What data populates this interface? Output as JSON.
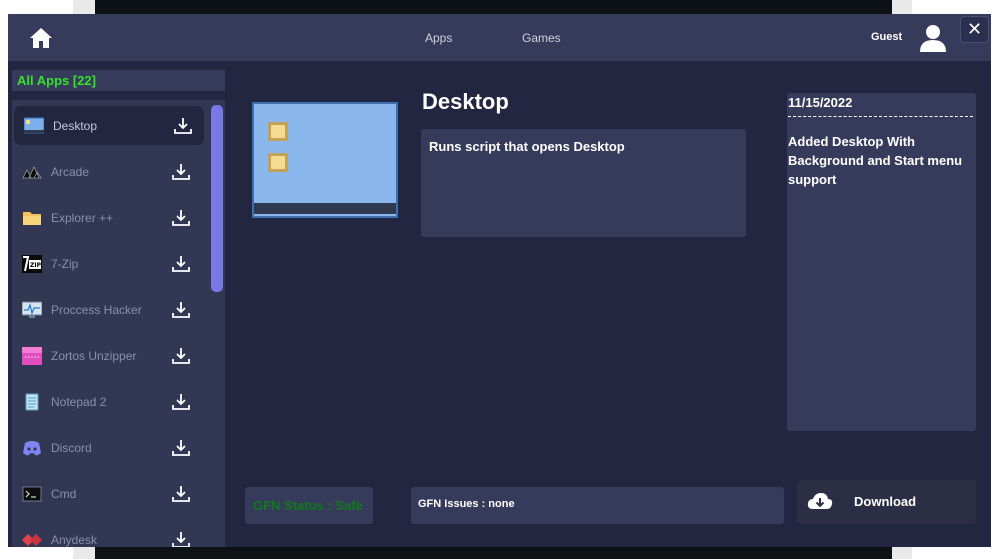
{
  "topbar": {
    "home_icon": "home-icon",
    "nav": [
      "Apps",
      "Games"
    ],
    "user_name": "Guest",
    "user_icon": "user-icon",
    "close_label": "✕"
  },
  "sidebar": {
    "header": "All Apps [22]",
    "items": [
      {
        "label": "Desktop",
        "icon": "desktop-icon",
        "selected": true
      },
      {
        "label": "Arcade",
        "icon": "arcade-icon"
      },
      {
        "label": "Explorer ++",
        "icon": "folder-icon"
      },
      {
        "label": "7-Zip",
        "icon": "7zip-icon"
      },
      {
        "label": "Proccess Hacker",
        "icon": "process-hacker-icon"
      },
      {
        "label": "Zortos Unzipper",
        "icon": "zortos-icon"
      },
      {
        "label": "Notepad 2",
        "icon": "notepad-icon"
      },
      {
        "label": "Discord",
        "icon": "discord-icon"
      },
      {
        "label": "Cmd",
        "icon": "cmd-icon"
      },
      {
        "label": "Anydesk",
        "icon": "anydesk-icon"
      }
    ]
  },
  "detail": {
    "title": "Desktop",
    "description": "Runs script that opens Desktop",
    "changelog_date": "11/15/2022",
    "changelog_separator": "------------------------------",
    "changelog_text": "Added Desktop With Background and Start menu support",
    "gfn_status": "GFN Status : Safe",
    "gfn_issues": "GFN Issues : none",
    "download_label": "Download"
  },
  "colors": {
    "window_bg": "#222640",
    "panel_bg": "#363b5c",
    "accent_green": "#35e22c",
    "status_safe": "#0f7a17",
    "scrollbar": "#7a78e6"
  }
}
